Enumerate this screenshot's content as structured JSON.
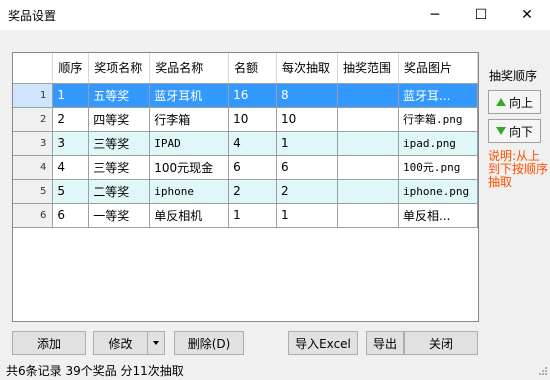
{
  "window": {
    "title": "奖品设置",
    "min_glyph": "─",
    "max_glyph": "☐",
    "close_glyph": "✕"
  },
  "grid": {
    "columns": [
      "顺序",
      "奖项名称",
      "奖品名称",
      "名额",
      "每次抽取",
      "抽奖范围",
      "奖品图片"
    ],
    "selected_row": 0,
    "rows": [
      {
        "num": "1",
        "order": "1",
        "level": "五等奖",
        "prize": "蓝牙耳机",
        "quota": "16",
        "per_draw": "8",
        "range": "",
        "image": "蓝牙耳..."
      },
      {
        "num": "2",
        "order": "2",
        "level": "四等奖",
        "prize": "行李箱",
        "quota": "10",
        "per_draw": "10",
        "range": "",
        "image": "行李箱.png"
      },
      {
        "num": "3",
        "order": "3",
        "level": "三等奖",
        "prize": "IPAD",
        "quota": "4",
        "per_draw": "1",
        "range": "",
        "image": "ipad.png"
      },
      {
        "num": "4",
        "order": "4",
        "level": "三等奖",
        "prize": "100元现金",
        "quota": "6",
        "per_draw": "6",
        "range": "",
        "image": "100元.png"
      },
      {
        "num": "5",
        "order": "5",
        "level": "二等奖",
        "prize": "iphone",
        "quota": "2",
        "per_draw": "2",
        "range": "",
        "image": "iphone.png"
      },
      {
        "num": "6",
        "order": "6",
        "level": "一等奖",
        "prize": "单反相机",
        "quota": "1",
        "per_draw": "1",
        "range": "",
        "image": "单反相..."
      }
    ]
  },
  "side": {
    "title": "抽奖顺序",
    "up_label": "向上",
    "down_label": "向下",
    "note": "说明:从上到下按顺序抽取",
    "up_icon": "arrow-up-icon",
    "down_icon": "arrow-down-icon"
  },
  "buttons": {
    "add": "添加",
    "edit": "修改",
    "delete": "删除(D)",
    "import": "导入Excel",
    "export": "导出",
    "close": "关闭"
  },
  "status": "共6条记录 39个奖品 分11次抽取",
  "colors": {
    "selected": "#3399ff",
    "alt_row": "#e0f7f7",
    "note": "#ff4f00",
    "arrow": "#37a82a"
  }
}
